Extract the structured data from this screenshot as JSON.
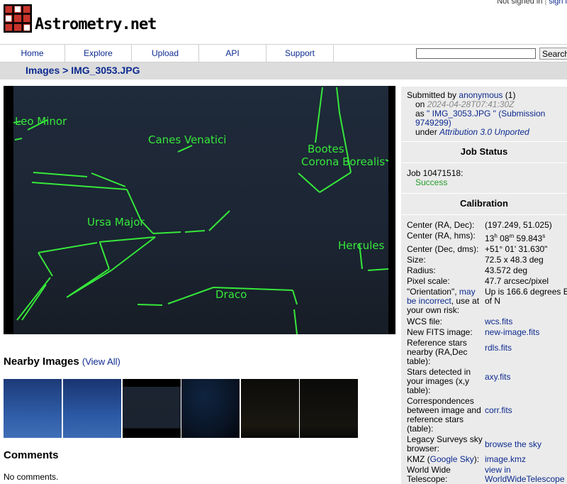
{
  "auth": {
    "not_signed_in": "Not signed in",
    "sign_in": "sign i"
  },
  "logo": {
    "text": "Astrometry.net"
  },
  "nav": {
    "items": [
      "Home",
      "Explore",
      "Upload",
      "API",
      "Support"
    ],
    "search_button": "Search",
    "search_value": ""
  },
  "breadcrumb": {
    "images": "Images",
    "sep": ">",
    "current": "IMG_3053.JPG"
  },
  "photo": {
    "labels": [
      "Leo Minor",
      "Canes Venatici",
      "Bootes",
      "Corona Borealis",
      "Ursa Major",
      "Hercules",
      "Draco"
    ],
    "line_color": "#36e83a"
  },
  "submission": {
    "submitted_by": "Submitted by",
    "user": "anonymous",
    "user_count": "(1)",
    "on": "on",
    "date": "2024-04-28T07:41:30Z",
    "as": "as",
    "filename": "\" IMG_3053.JPG \"",
    "submission_link": "(Submission 9749299)",
    "under": "under",
    "license": "Attribution 3.0 Unported"
  },
  "job_status": {
    "title": "Job Status",
    "job": "Job 10471518:",
    "status": "Success",
    "status_color": "#239c28"
  },
  "calibration": {
    "title": "Calibration",
    "ra_dec_key": "Center (RA, Dec):",
    "ra_dec": "(197.249, 51.025)",
    "ra_hms_key": "Center (RA, hms):",
    "ra_h": "13",
    "ra_m": "08",
    "ra_s": "59.843",
    "dec_dms_key": "Center (Dec, dms):",
    "dec_dms": "+51° 01' 31.630\"",
    "size_key": "Size:",
    "size": "72.5 x 48.3 deg",
    "radius_key": "Radius:",
    "radius": "43.572 deg",
    "pixscale_key": "Pixel scale:",
    "pixscale": "47.7 arcsec/pixel",
    "orient_pre": "\"Orientation\",",
    "orient_link": "may be incorrect",
    "orient_post": ", use at your own risk:",
    "orient_value": "Up is 166.6 degrees E of N",
    "wcs_key": "WCS file:",
    "wcs": "wcs.fits",
    "newfits_key": "New FITS image:",
    "newfits": "new-image.fits",
    "rdls_key": "Reference stars nearby (RA,Dec table):",
    "rdls": "rdls.fits",
    "axy_key": "Stars detected in your images (x,y table):",
    "axy": "axy.fits",
    "corr_key": "Correspondences between image and reference stars (table):",
    "corr": "corr.fits",
    "legacy_key": "Legacy Surveys sky browser:",
    "legacy": "browse the sky",
    "kmz_key_pre": "KMZ (",
    "kmz_key_link": "Google Sky",
    "kmz_key_post": "):",
    "kmz": "image.kmz",
    "wwt_key": "World Wide Telescope:",
    "wwt": "view in WorldWideTelescope"
  },
  "nearby": {
    "title": "Nearby Images",
    "view_all": "(View All)"
  },
  "comments": {
    "title": "Comments",
    "none": "No comments."
  }
}
